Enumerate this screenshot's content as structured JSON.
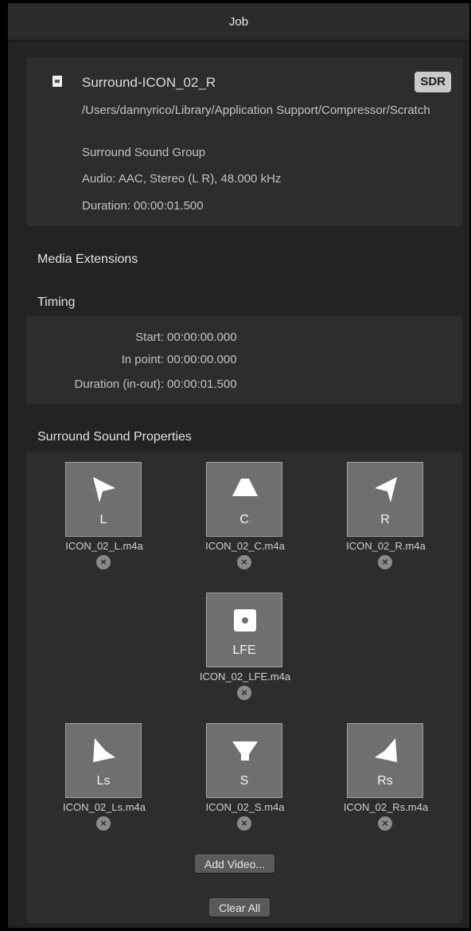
{
  "window": {
    "title": "Job"
  },
  "file": {
    "name": "Surround-ICON_02_R",
    "badge": "SDR",
    "path": "/Users/dannyrico/Library/Application Support/Compressor/Scratch",
    "group": "Surround Sound Group",
    "audio": "Audio: AAC, Stereo (L R), 48.000 kHz",
    "duration": "Duration: 00:00:01.500"
  },
  "media_extensions": {
    "label": "Media Extensions"
  },
  "timing": {
    "label": "Timing",
    "rows": [
      {
        "key": "Start:",
        "value": "00:00:00.000"
      },
      {
        "key": "In point:",
        "value": "00:00:00.000"
      },
      {
        "key": "Duration (in-out):",
        "value": "00:00:01.500"
      }
    ]
  },
  "surround": {
    "label": "Surround Sound Properties",
    "channels": [
      {
        "label": "L",
        "file": "ICON_02_L.m4a",
        "icon": "speaker-left-icon"
      },
      {
        "label": "C",
        "file": "ICON_02_C.m4a",
        "icon": "speaker-center-icon"
      },
      {
        "label": "R",
        "file": "ICON_02_R.m4a",
        "icon": "speaker-right-icon"
      },
      {
        "label": "LFE",
        "file": "ICON_02_LFE.m4a",
        "icon": "subwoofer-icon"
      },
      {
        "label": "Ls",
        "file": "ICON_02_Ls.m4a",
        "icon": "speaker-left-surround-icon"
      },
      {
        "label": "S",
        "file": "ICON_02_S.m4a",
        "icon": "speaker-surround-icon"
      },
      {
        "label": "Rs",
        "file": "ICON_02_Rs.m4a",
        "icon": "speaker-right-surround-icon"
      }
    ],
    "remove_symbol": "×",
    "add_video_label": "Add Video...",
    "clear_all_label": "Clear All"
  }
}
